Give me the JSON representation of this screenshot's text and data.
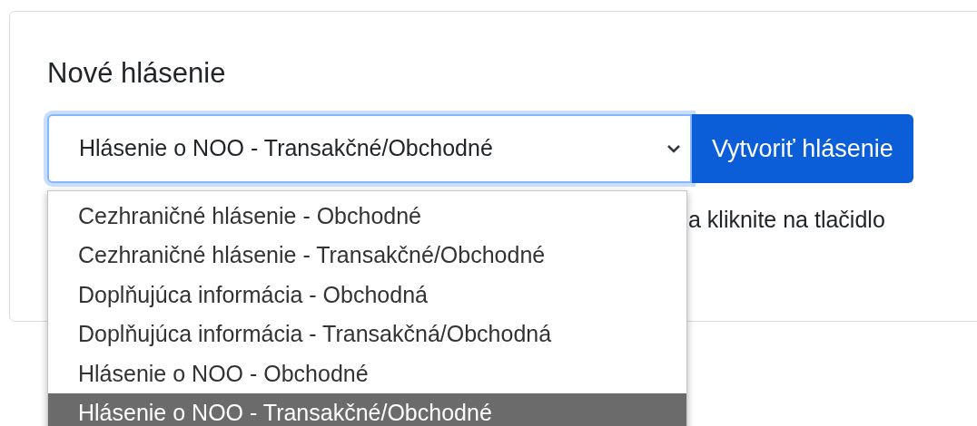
{
  "card": {
    "title": "Nové hlásenie",
    "select": {
      "value": "Hlásenie o NOO - Transakčné/Obchodné",
      "focused": true
    },
    "button": "Vytvoriť hlásenie",
    "hint": "a kliknite na tlačidlo"
  },
  "dropdown": {
    "options": [
      {
        "label": "Cezhraničné hlásenie - Obchodné",
        "selected": false
      },
      {
        "label": "Cezhraničné hlásenie - Transakčné/Obchodné",
        "selected": false
      },
      {
        "label": "Doplňujúca informácia - Obchodná",
        "selected": false
      },
      {
        "label": "Doplňujúca informácia - Transakčná/Obchodná",
        "selected": false
      },
      {
        "label": "Hlásenie o NOO - Obchodné",
        "selected": false
      },
      {
        "label": "Hlásenie o NOO - Transakčné/Obchodné",
        "selected": true
      }
    ]
  }
}
